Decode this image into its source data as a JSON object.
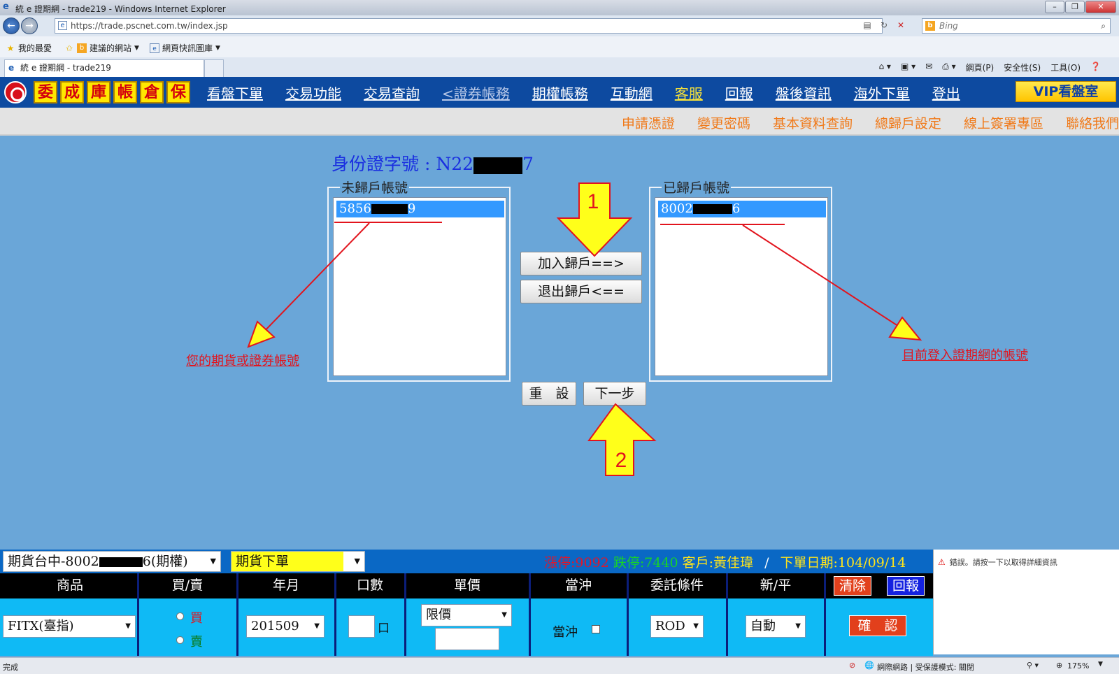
{
  "browser": {
    "title": "統 e 證期網 - trade219 - Windows Internet Explorer",
    "url": "https://trade.pscnet.com.tw/index.jsp",
    "search_placeholder": "Bing",
    "favorites": {
      "favorites_label": "我的最愛",
      "suggested_sites": "建議的網站",
      "web_slice_gallery": "網頁快訊圖庫"
    },
    "tab_title": "統 e 證期網 - trade219",
    "command_bar": {
      "page": "網頁(P)",
      "safety": "安全性(S)",
      "tools": "工具(O)"
    },
    "status_left": "完成",
    "status_zone": "網際網路 | 受保護模式: 關閉",
    "zoom": "175%",
    "error_notice": "錯誤。請按一下以取得詳細資訊"
  },
  "site": {
    "quick_boxes": [
      "委",
      "成",
      "庫",
      "帳",
      "倉",
      "保"
    ],
    "nav": [
      {
        "label": "看盤下單",
        "style": "normal"
      },
      {
        "label": "交易功能",
        "style": "normal"
      },
      {
        "label": "交易查詢",
        "style": "normal"
      },
      {
        "label": "<證券帳務",
        "style": "dim"
      },
      {
        "label": "期權帳務",
        "style": "normal"
      },
      {
        "label": "互動網",
        "style": "normal"
      },
      {
        "label": "客服",
        "style": "hi"
      },
      {
        "label": "回報",
        "style": "normal"
      },
      {
        "label": "盤後資訊",
        "style": "normal"
      },
      {
        "label": "海外下單",
        "style": "normal"
      },
      {
        "label": "登出",
        "style": "normal"
      }
    ],
    "vip_label": "VIP看盤室",
    "subnav": [
      "申請憑證",
      "變更密碼",
      "基本資料查詢",
      "總歸戶設定",
      "線上簽署專區",
      "聯絡我們"
    ]
  },
  "main": {
    "id_label": "身份證字號 : N22",
    "id_suffix": "7",
    "unlinked": {
      "legend": "未歸戶帳號",
      "item_prefix": "5856",
      "item_suffix": "9"
    },
    "linked": {
      "legend": "已歸戶帳號",
      "item_prefix": "8002",
      "item_suffix": "6"
    },
    "add_button": "加入歸戶==>",
    "remove_button": "退出歸戶<==",
    "reset_button": "重　設",
    "next_button": "下一步",
    "annotation_left": "您的期貨或證券帳號",
    "annotation_right": "目前登入證期網的帳號",
    "marker_1": "1",
    "marker_2": "2"
  },
  "order_panel": {
    "account_prefix": "期貨台中-8002",
    "account_suffix": "6(期權)",
    "mode": "期貨下單",
    "limit_up": "漲停:9092",
    "limit_down": "跌停:7440",
    "customer": "客戶:黃佳瑋",
    "separator": "/",
    "order_date": "下單日期:104/09/14",
    "headers": [
      "商品",
      "買/賣",
      "年月",
      "口數",
      "單價",
      "當沖",
      "委託條件",
      "新/平"
    ],
    "clear_button": "清除",
    "report_button": "回報",
    "product": "FITX(臺指)",
    "buy_label": "買",
    "sell_label": "賣",
    "year_month": "201509",
    "lots_unit": "口",
    "price_type": "限價",
    "daytrade_label": "當沖",
    "condition": "ROD",
    "open_close": "自動",
    "confirm_button": "確　認"
  },
  "colors": {
    "page_bg": "#6aa6d8",
    "nav_bg": "#0d4aa0",
    "accent_orange": "#f07a1a",
    "annotation_red": "#e2141d",
    "arrow_yellow": "#ffff1a",
    "selection_blue": "#3399ff"
  }
}
